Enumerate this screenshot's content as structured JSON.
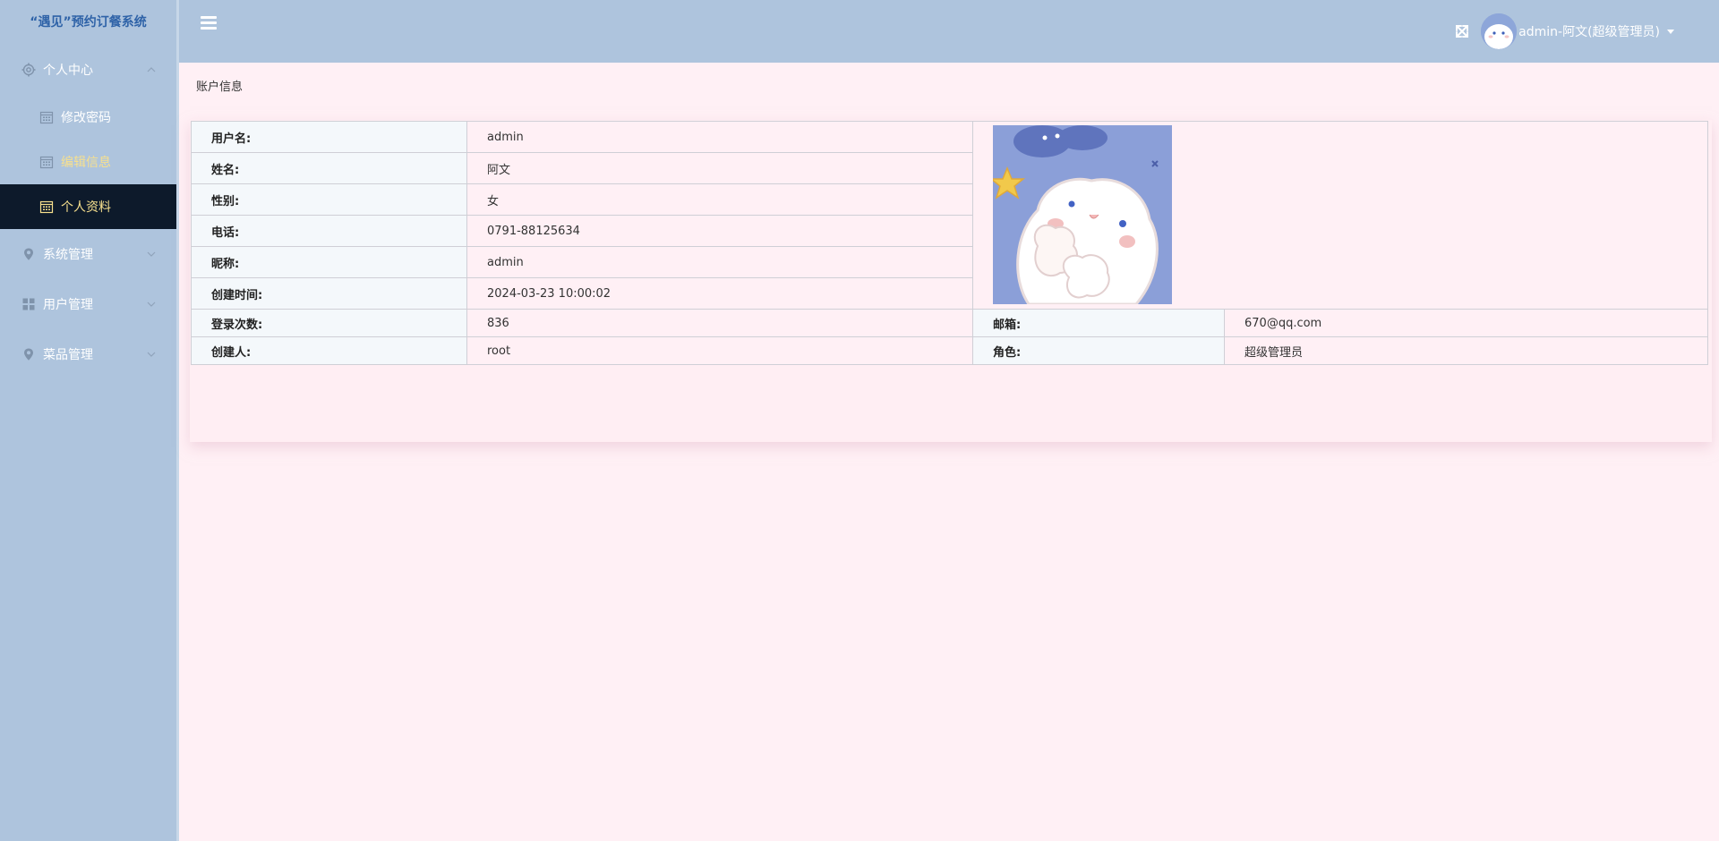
{
  "sidebar": {
    "brand": "“遇见”预约订餐系统",
    "menu": [
      {
        "label": "个人中心",
        "icon": "gear-icon",
        "expanded": true,
        "children": [
          {
            "label": "修改密码",
            "icon": "calendar-icon"
          },
          {
            "label": "编辑信息",
            "icon": "calendar-icon"
          },
          {
            "label": "个人资料",
            "icon": "calendar-icon"
          }
        ]
      },
      {
        "label": "系统管理",
        "icon": "location-pin-icon"
      },
      {
        "label": "用户管理",
        "icon": "grid-icon"
      },
      {
        "label": "菜品管理",
        "icon": "location-pin-icon"
      }
    ]
  },
  "header": {
    "user_label": "admin-阿文(超级管理员)"
  },
  "page": {
    "title": "账户信息"
  },
  "account": {
    "rows": [
      {
        "label": "用户名:",
        "value": "admin"
      },
      {
        "label": "姓名:",
        "value": "阿文"
      },
      {
        "label": "性别:",
        "value": "女"
      },
      {
        "label": "电话:",
        "value": "0791-88125634"
      },
      {
        "label": "昵称:",
        "value": "admin"
      },
      {
        "label": "创建时间:",
        "value": "2024-03-23 10:00:02"
      }
    ],
    "login_count_label": "登录次数:",
    "login_count": "836",
    "email_label": "邮箱:",
    "email": "670@qq.com",
    "creator_label": "创建人:",
    "creator": "root",
    "role_label": "角色:",
    "role": "超级管理员"
  },
  "colors": {
    "sidebar_bg": "#aec4dd",
    "active_item_bg": "#0d1a2b",
    "active_text": "#f7e08e",
    "content_bg": "#fff0f5",
    "brand_text": "#2f63a8"
  }
}
